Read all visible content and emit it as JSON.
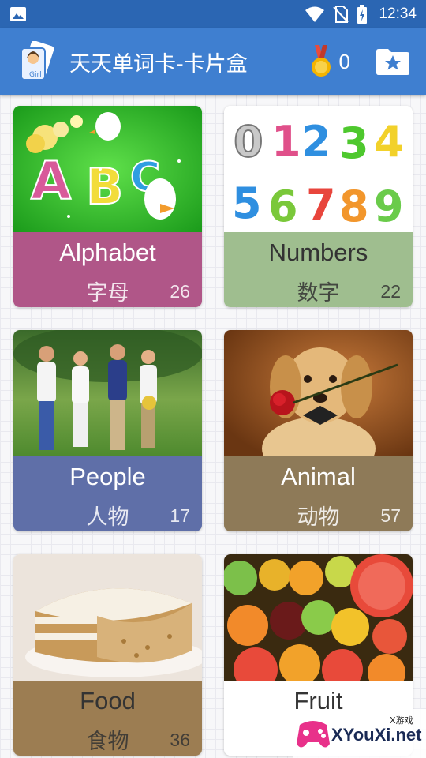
{
  "status_bar": {
    "time": "12:34",
    "icons": [
      "image-icon",
      "wifi-icon",
      "no-sim-icon",
      "battery-charging-icon"
    ]
  },
  "app_bar": {
    "title": "天天单词卡-卡片盒",
    "logo_icon": "app-logo-icon",
    "medal_icon": "medal-icon",
    "medal_count": "0",
    "favorites_icon": "star-folder-icon"
  },
  "colors": {
    "status_bar": "#2b66b3",
    "app_bar": "#3f7fd0",
    "alphabet": "#b05688",
    "numbers": "#9fbe8f",
    "people": "#5f6fa8",
    "animal": "#8e7a58",
    "food": "#9c7d52",
    "fruit": "#ffffff"
  },
  "cards": [
    {
      "title": "Alphabet",
      "subtitle": "字母",
      "count": "26"
    },
    {
      "title": "Numbers",
      "subtitle": "数字",
      "count": "22"
    },
    {
      "title": "People",
      "subtitle": "人物",
      "count": "17"
    },
    {
      "title": "Animal",
      "subtitle": "动物",
      "count": "57"
    },
    {
      "title": "Food",
      "subtitle": "食物",
      "count": "36"
    },
    {
      "title": "Fruit",
      "subtitle": "",
      "count": ""
    }
  ],
  "numbers_image": {
    "digits": [
      "0",
      "1",
      "2",
      "3",
      "4",
      "5",
      "6",
      "7",
      "8",
      "9"
    ]
  },
  "alphabet_image": {
    "letters": [
      "A",
      "B",
      "C"
    ]
  },
  "watermark": {
    "small": "X游戏",
    "text": "XYouXi.net"
  }
}
